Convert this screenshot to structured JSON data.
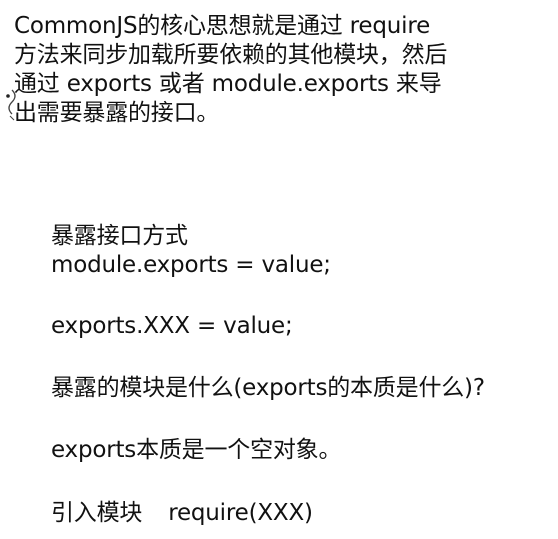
{
  "intro": {
    "lines": [
      "CommonJS的核心思想就是通过 require",
      "方法来同步加载所要依赖的其他模块，然后",
      "通过 exports 或者 module.exports 来导",
      "出需要暴露的接口。"
    ]
  },
  "notes": {
    "expose_heading": "暴露接口方式",
    "expose_module": "module.exports = value;",
    "expose_exports": "exports.XXX = value;",
    "question": "暴露的模块是什么(exports的本质是什么)?",
    "answer": "exports本质是一个空对象。",
    "import_label": "引入模块",
    "import_code": "require(XXX)"
  }
}
